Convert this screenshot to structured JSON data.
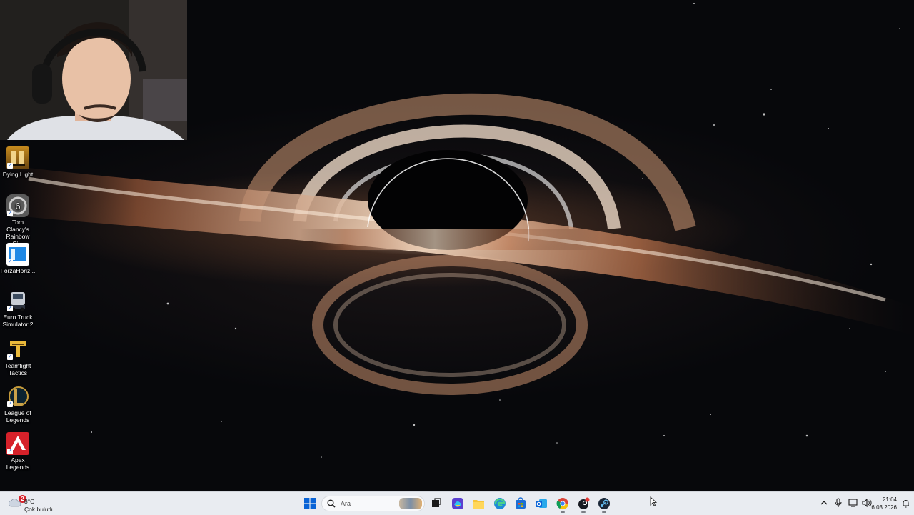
{
  "desktop": {
    "icons": [
      {
        "label": "Dying Light",
        "icon": "dying-light-icon"
      },
      {
        "label": "Tom Clancy's Rainbow Si...",
        "icon": "rainbow-six-icon"
      },
      {
        "label": "ForzaHoriz...",
        "icon": "forza-horizon-icon"
      },
      {
        "label": "Euro Truck Simulator 2",
        "icon": "euro-truck-icon"
      },
      {
        "label": "Teamfight Tactics",
        "icon": "teamfight-tactics-icon"
      },
      {
        "label": "League of Legends",
        "icon": "league-of-legends-icon"
      },
      {
        "label": "Apex Legends",
        "icon": "apex-legends-icon"
      }
    ]
  },
  "taskbar": {
    "weather": {
      "badge": "2",
      "temperature": "8°C",
      "condition": "Çok bulutlu",
      "icon": "cloud-icon"
    },
    "search": {
      "placeholder": "Ara",
      "icon": "search-icon"
    },
    "apps": [
      {
        "name": "start",
        "icon": "windows-start-icon"
      },
      {
        "name": "task-view",
        "icon": "task-view-icon"
      },
      {
        "name": "copilot",
        "icon": "copilot-icon"
      },
      {
        "name": "file-explorer",
        "icon": "folder-icon"
      },
      {
        "name": "edge",
        "icon": "edge-icon"
      },
      {
        "name": "store",
        "icon": "store-icon"
      },
      {
        "name": "outlook",
        "icon": "outlook-icon"
      },
      {
        "name": "chrome",
        "icon": "chrome-icon"
      },
      {
        "name": "steam-notify",
        "icon": "steam-notify-icon"
      },
      {
        "name": "steam",
        "icon": "steam-icon"
      }
    ],
    "clock": {
      "time": "21:04",
      "date": "16.03.2026"
    }
  },
  "colors": {
    "taskbar_bg": "#e9ecf1",
    "accent_blue": "#0a64d6",
    "badge_red": "#d8242c"
  }
}
